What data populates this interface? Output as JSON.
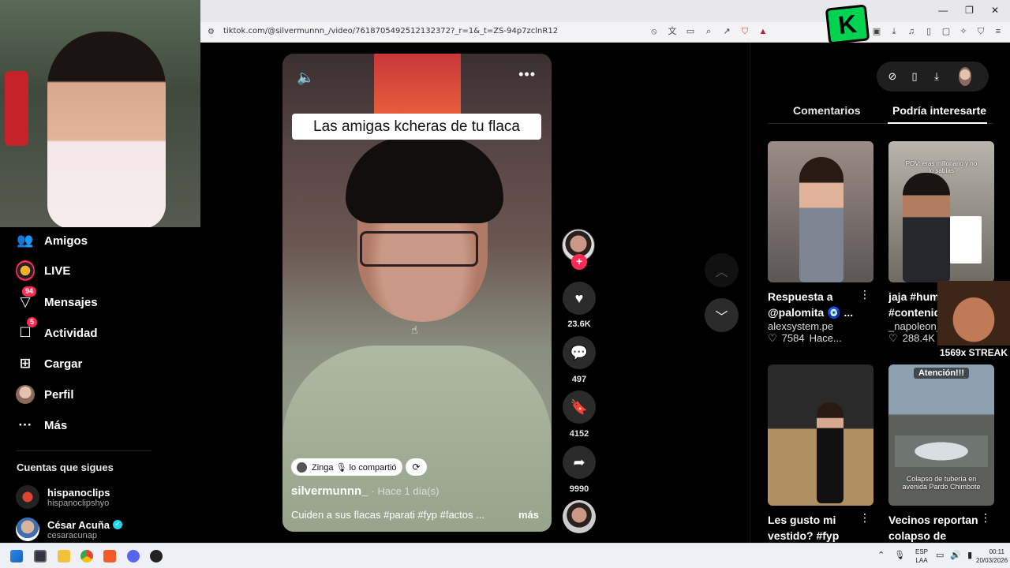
{
  "browser": {
    "url": "tiktok.com/@silvermunnn_/video/7618705492512132372?_r=1&_t=ZS-94p7zclnR12"
  },
  "sidebar": {
    "items": [
      {
        "label": "Amigos",
        "icon": "friends-icon"
      },
      {
        "label": "LIVE",
        "icon": "live-icon"
      },
      {
        "label": "Mensajes",
        "icon": "messages-icon",
        "badge": "94"
      },
      {
        "label": "Actividad",
        "icon": "activity-icon",
        "badge": "5"
      },
      {
        "label": "Cargar",
        "icon": "upload-icon"
      },
      {
        "label": "Perfil",
        "icon": "profile-avatar"
      },
      {
        "label": "Más",
        "icon": "more-icon"
      }
    ],
    "following_title": "Cuentas que sigues",
    "following": [
      {
        "name": "hispanoclips",
        "handle": "hispanoclipshyo",
        "verified": false
      },
      {
        "name": "César Acuña",
        "handle": "cesaracunap",
        "verified": true
      }
    ]
  },
  "video": {
    "caption": "Las amigas kcheras de tu flaca",
    "shared_by": "Zinga 🎙 lo compartió",
    "author": "silvermunnn_",
    "time": "· Hace 1 día(s)",
    "description": "Cuiden a sus flacas #parati #fyp #factos ...",
    "more": "más"
  },
  "actions": {
    "likes": "23.6K",
    "comments": "497",
    "saves": "4152",
    "shares": "9990"
  },
  "panel": {
    "tab_comments": "Comentarios",
    "tab_recs": "Podría interesarte",
    "cards": [
      {
        "title": "Respuesta a @palomita 🧿 ...",
        "author": "alexsystem.pe",
        "likes": "7584",
        "time": "Hace...",
        "thumb_top": "#9a8c86",
        "thumb_bottom": "#5c5656"
      },
      {
        "title": "jaja #humor #contenido",
        "author": "_napoleon_1",
        "likes": "288.4K",
        "time": "",
        "overlay": "POV: eras millonario y no lo sabías",
        "thumb_top": "#b9b4ac",
        "thumb_bottom": "#6f6a62"
      },
      {
        "title": "Les gusto mi vestido? #fyp",
        "author": "",
        "likes": "",
        "time": "",
        "thumb_top": "#2a2a2a",
        "thumb_bottom": "#b09060"
      },
      {
        "title": "Vecinos reportan colapso de tuber...",
        "author": "",
        "likes": "",
        "time": "",
        "badge": "Atención!!!",
        "overlay": "Colapso de tubería en avenida Pardo Chimbote",
        "thumb_top": "#8da0b0",
        "thumb_bottom": "#5d5f5a"
      }
    ]
  },
  "streak": {
    "text": "1569x STREAK"
  },
  "taskbar": {
    "lang_line1": "ESP",
    "lang_line2": "LAA",
    "time": "00:11",
    "date": "20/03/2026"
  },
  "colors": {
    "accent": "#fe2c55",
    "badge_blue": "#20d5ec",
    "kick_green": "#00d34f"
  }
}
